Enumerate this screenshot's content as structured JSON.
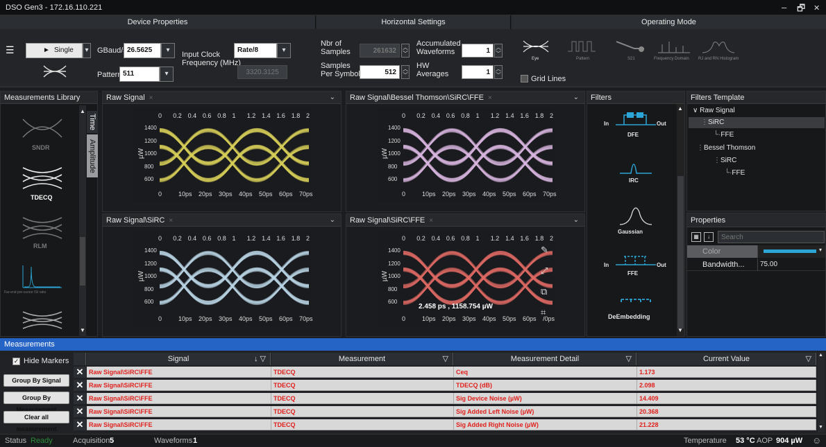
{
  "window": {
    "title": "DSO Gen3 - 172.16.110.221",
    "min": "–",
    "restore": "🗗",
    "close": "✕"
  },
  "device": {
    "header": "Device Properties",
    "single_label": "Single",
    "gbaud_label": "GBaud/s",
    "gbaud_value": "26.5625",
    "input_clock_label": "Input Clock",
    "freq_label": "Frequency (MHz)",
    "rate_value": "Rate/8",
    "freq_value": "3320.3125",
    "pattern_label": "Pattern",
    "pattern_value": "511"
  },
  "horizontal": {
    "header": "Horizontal Settings",
    "nbr_label": "Nbr of",
    "samples_label": "Samples",
    "nbr_value": "261632",
    "samples_per_label": "Samples",
    "per_symbol_label": "Per Symbol",
    "sps_value": "512",
    "accum_label": "Accumulated",
    "waveforms_label": "Waveforms",
    "accum_value": "1",
    "hw_label": "HW",
    "averages_label": "Averages",
    "hw_value": "1"
  },
  "operating": {
    "header": "Operating Mode",
    "modes": [
      "Eye",
      "Pattern",
      "S21",
      "Frequency Domain",
      "RJ and RN Histogram"
    ],
    "grid_lines": "Grid Lines"
  },
  "library": {
    "header": "Measurements Library",
    "items": [
      "SNDR",
      "TDECQ",
      "RLM",
      "Far-end pre-cursor ISI ratio"
    ],
    "tab_time": "Time",
    "tab_amplitude": "Amplitude"
  },
  "plots": [
    {
      "title": "Raw Signal",
      "color": "#d8d05a"
    },
    {
      "title": "Raw Signal\\Bessel Thomson\\SiRC\\FFE",
      "color": "#d9b6e0"
    },
    {
      "title": "Raw Signal\\SiRC",
      "color": "#b9d6e6"
    },
    {
      "title": "Raw Signal\\SiRC\\FFE",
      "color": "#e06a64"
    }
  ],
  "axes": {
    "top_ticks": [
      "0",
      "0.2",
      "0.4",
      "0.6",
      "0.8",
      "1",
      "1.2",
      "1.4",
      "1.6",
      "1.8",
      "2"
    ],
    "bottom_ticks": [
      "0",
      "10ps",
      "20ps",
      "30ps",
      "40ps",
      "50ps",
      "60ps",
      "70ps"
    ],
    "bottom_ticks_alt": [
      "0",
      "10ps",
      "20ps",
      "30ps",
      "40ps",
      "50ps",
      "60ps",
      "/0ps"
    ],
    "y_ticks": [
      "1400",
      "1200",
      "1000",
      "800",
      "600"
    ],
    "y_unit": "µW",
    "cursor_readout": "2.458  ps , 1158.754  µW"
  },
  "filters": {
    "header": "Filters",
    "items": [
      "DFE",
      "IRC",
      "Gaussian",
      "FFE",
      "DeEmbedding"
    ],
    "in": "In",
    "out": "Out"
  },
  "template": {
    "header": "Filters Template",
    "tree": [
      "Raw Signal",
      "SiRC",
      "FFE",
      "Bessel Thomson",
      "SiRC",
      "FFE"
    ]
  },
  "properties": {
    "header": "Properties",
    "search_placeholder": "Search",
    "rows": [
      {
        "name": "Color",
        "value": ""
      },
      {
        "name": "Bandwidth...",
        "value": "75.00"
      }
    ],
    "color_value": "#2ba6d6"
  },
  "measurements": {
    "header": "Measurements",
    "hide_markers": "Hide Markers",
    "group_by_signal": "Group By Signal",
    "group_by_measurement": "Group By Measurement",
    "clear_all": "Clear all measurement",
    "columns": [
      "Signal",
      "Measurement",
      "Measurement Detail",
      "Current Value"
    ],
    "rows": [
      {
        "signal": "Raw Signal\\SiRC\\FFE",
        "measurement": "TDECQ",
        "detail": "Ceq",
        "value": "1.173"
      },
      {
        "signal": "Raw Signal\\SiRC\\FFE",
        "measurement": "TDECQ",
        "detail": "TDECQ (dB)",
        "value": "2.098"
      },
      {
        "signal": "Raw Signal\\SiRC\\FFE",
        "measurement": "TDECQ",
        "detail": "Sig Device Noise (µW)",
        "value": "14.409"
      },
      {
        "signal": "Raw Signal\\SiRC\\FFE",
        "measurement": "TDECQ",
        "detail": "Sig Added Left Noise (µW)",
        "value": "20.368"
      },
      {
        "signal": "Raw Signal\\SiRC\\FFE",
        "measurement": "TDECQ",
        "detail": "Sig Added Right Noise (µW)",
        "value": "21.228"
      }
    ]
  },
  "status": {
    "status_label": "Status",
    "status_value": "Ready",
    "acq_label": "Acquisition",
    "acq_value": "5",
    "wf_label": "Waveforms",
    "wf_value": "1",
    "temp_label": "Temperature",
    "temp_value": "53 °C",
    "aop_label": "AOP",
    "aop_value": "904 µW"
  }
}
